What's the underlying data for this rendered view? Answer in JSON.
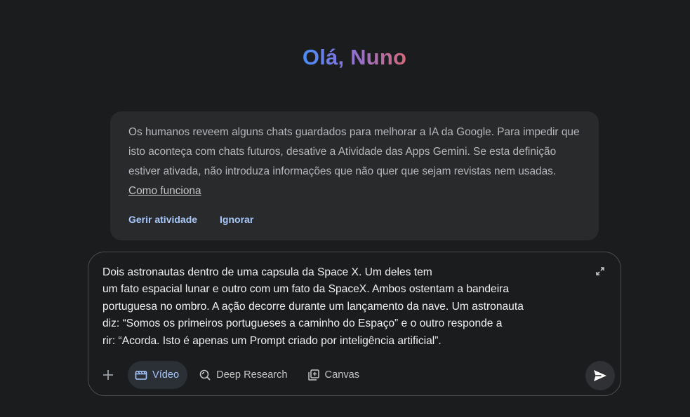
{
  "greeting": "Olá, Nuno",
  "notice": {
    "text": "Os humanos reveem alguns chats guardados para melhorar a IA da Google. Para impedir que isto aconteça com chats futuros, desative a Atividade das Apps Gemini. Se esta definição estiver ativada, não introduza informações que não quer que sejam revistas nem usadas.",
    "link": "Como funciona",
    "actions": {
      "manage": "Gerir atividade",
      "dismiss": "Ignorar"
    }
  },
  "composer": {
    "prompt": "Dois astronautas dentro de uma capsula da Space X. Um deles tem\num fato espacial lunar e outro com um fato da SpaceX. Ambos ostentam a bandeira\nportuguesa no ombro. A ação decorre durante um lançamento da nave. Um astronauta\ndiz: “Somos os primeiros portugueses a caminho do Espaço” e o outro responde a\nrir: “Acorda. Isto é apenas um Prompt criado por inteligência artificial”.",
    "tools": {
      "video": "Vídeo",
      "deep_research": "Deep Research",
      "canvas": "Canvas"
    },
    "icons": [
      "plus-icon",
      "video-icon",
      "deep-research-icon",
      "canvas-icon",
      "expand-icon",
      "send-icon"
    ]
  },
  "colors": {
    "background": "#1b1c1d",
    "card": "#282a2c",
    "accent": "#a8c7fa"
  }
}
